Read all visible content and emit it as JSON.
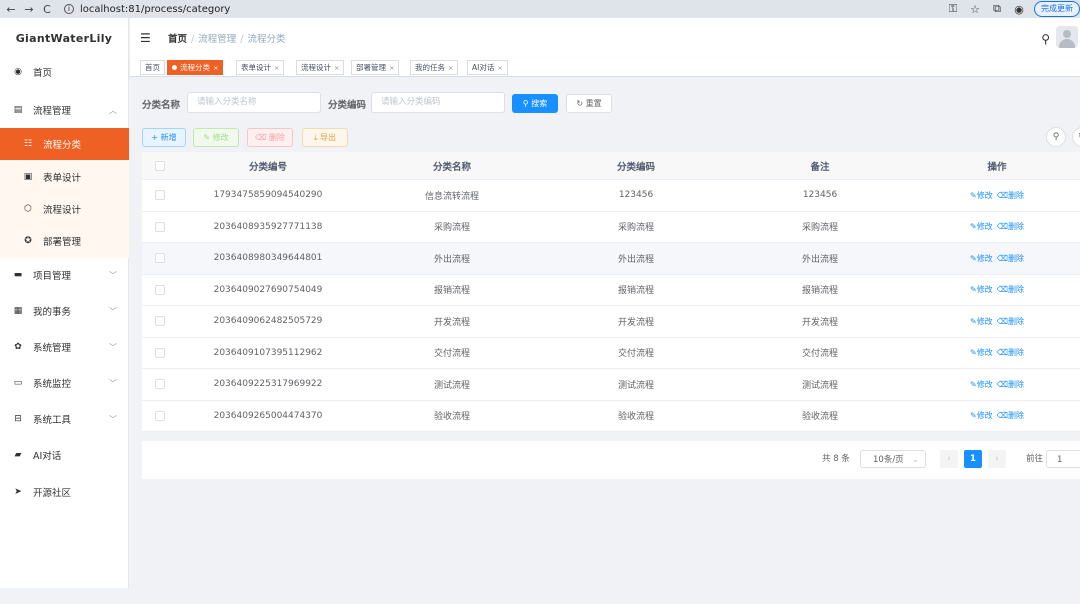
{
  "browser": {
    "url": "localhost:81/process/category",
    "update_label": "完成更新",
    "back_icon": "←",
    "forward_icon": "→",
    "reload_icon": "C"
  },
  "sidebar": {
    "logo": "GiantWaterLily",
    "items": [
      {
        "label": "首页",
        "icon": "dashboard-icon"
      },
      {
        "label": "流程管理",
        "icon": "flow-icon"
      },
      {
        "label": "流程分类",
        "icon": "tree-icon",
        "active": true
      },
      {
        "label": "表单设计",
        "icon": "form-icon"
      },
      {
        "label": "流程设计",
        "icon": "design-icon"
      },
      {
        "label": "部署管理",
        "icon": "deploy-icon"
      },
      {
        "label": "项目管理",
        "icon": "folder-icon"
      },
      {
        "label": "我的事务",
        "icon": "task-icon"
      },
      {
        "label": "系统管理",
        "icon": "system-icon"
      },
      {
        "label": "系统监控",
        "icon": "monitor-icon"
      },
      {
        "label": "系统工具",
        "icon": "tool-icon"
      },
      {
        "label": "AI对话",
        "icon": "chat-icon"
      },
      {
        "label": "开源社区",
        "icon": "send-icon"
      }
    ]
  },
  "header": {
    "breadcrumb": [
      "首页",
      "流程管理",
      "流程分类"
    ]
  },
  "tags": [
    {
      "label": "首页"
    },
    {
      "label": "流程分类",
      "active": true
    },
    {
      "label": "表单设计"
    },
    {
      "label": "流程设计"
    },
    {
      "label": "部署管理"
    },
    {
      "label": "我的任务"
    },
    {
      "label": "AI对话"
    }
  ],
  "search": {
    "name_label": "分类名称",
    "name_placeholder": "请输入分类名称",
    "code_label": "分类编码",
    "code_placeholder": "请输入分类编码",
    "search_btn": "搜索",
    "reset_btn": "重置"
  },
  "toolbar": {
    "add": "新增",
    "edit": "修改",
    "delete": "删除",
    "export": "导出"
  },
  "table": {
    "headers": [
      "分类编号",
      "分类名称",
      "分类编码",
      "备注",
      "操作"
    ],
    "edit_label": "修改",
    "delete_label": "删除",
    "rows": [
      [
        "1793475859094540290",
        "信息流转流程",
        "123456",
        "123456"
      ],
      [
        "2036408935927771138",
        "采购流程",
        "采购流程",
        "采购流程"
      ],
      [
        "2036408980349644801",
        "外出流程",
        "外出流程",
        "外出流程"
      ],
      [
        "2036409027690754049",
        "报销流程",
        "报销流程",
        "报销流程"
      ],
      [
        "2036409062482505729",
        "开发流程",
        "开发流程",
        "开发流程"
      ],
      [
        "2036409107395112962",
        "交付流程",
        "交付流程",
        "交付流程"
      ],
      [
        "2036409225317969922",
        "测试流程",
        "测试流程",
        "测试流程"
      ],
      [
        "2036409265004474370",
        "验收流程",
        "验收流程",
        "验收流程"
      ]
    ]
  },
  "pagination": {
    "total": "共 8 条",
    "page_size": "10条/页",
    "current_page": "1",
    "goto_label": "前往",
    "goto_value": "1"
  }
}
